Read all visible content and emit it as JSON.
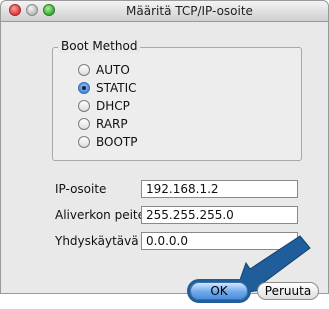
{
  "window": {
    "title": "Määritä TCP/IP-osoite"
  },
  "boot_method": {
    "label": "Boot Method",
    "options": [
      {
        "label": "AUTO",
        "selected": false
      },
      {
        "label": "STATIC",
        "selected": true
      },
      {
        "label": "DHCP",
        "selected": false
      },
      {
        "label": "RARP",
        "selected": false
      },
      {
        "label": "BOOTP",
        "selected": false
      }
    ]
  },
  "fields": {
    "ip": {
      "label": "IP-osoite",
      "value": "192.168.1.2"
    },
    "subnet": {
      "label": "Aliverkon peite",
      "value": "255.255.255.0"
    },
    "gateway": {
      "label": "Yhdyskäytävä",
      "value": "0.0.0.0"
    }
  },
  "buttons": {
    "ok": "OK",
    "cancel": "Peruuta"
  },
  "colors": {
    "highlight_arrow": "#1f5e9a",
    "ok_button": "#4c8fde"
  }
}
